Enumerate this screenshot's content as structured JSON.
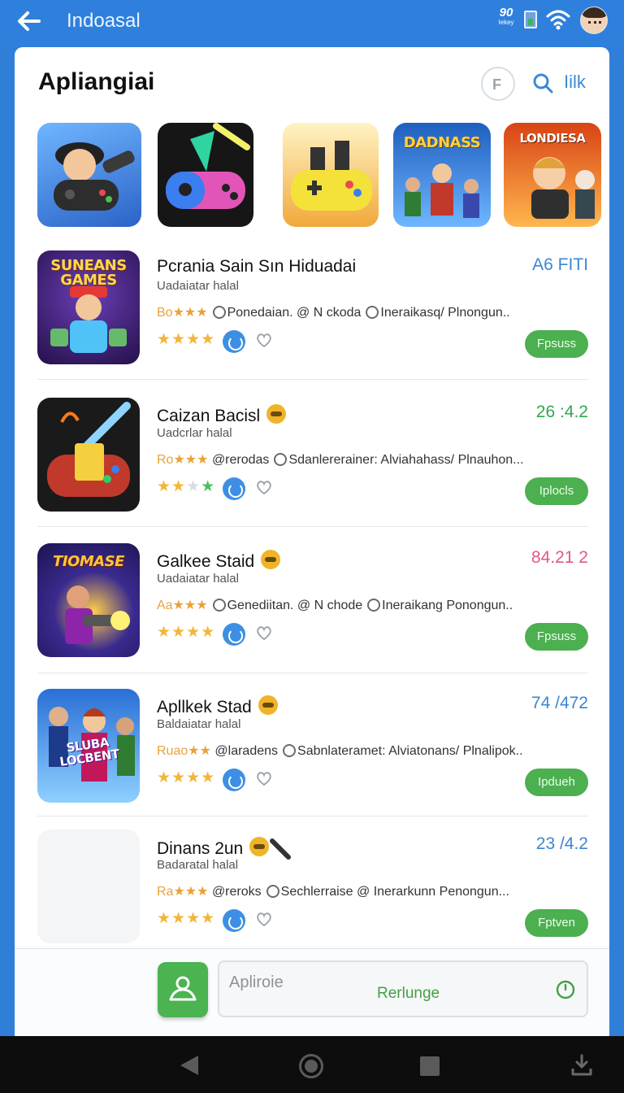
{
  "top_bar": {
    "title": "Indoasal",
    "status_big": "90",
    "status_small": "Iekey"
  },
  "header": {
    "title": "Apliangiai",
    "filter_label": "F",
    "link_label": "Iilk"
  },
  "carousel": [
    {
      "name": "tile-controller-boy",
      "text": ""
    },
    {
      "name": "tile-neon-controller",
      "text": ""
    },
    {
      "name": "tile-yellow-controller",
      "text": ""
    },
    {
      "name": "tile-dadnass",
      "text": "DADNASS"
    },
    {
      "name": "tile-lonnaqesa",
      "text": "LONDIESA"
    }
  ],
  "apps": [
    {
      "name": "Pcrania Sain Sın Hiduadai",
      "sub": "Uadaiatar halal",
      "rating": "Bo★★★",
      "meta": "Ponedaian. @ N ckoda",
      "meta2": "Ineraikasq/ Plnongun..",
      "version": "A6 FITI",
      "version_color": "#3a86d4",
      "action": "Fpsuss",
      "icon_text": "SUNEANS GAMES"
    },
    {
      "name": "Caizan Bacisl",
      "sub": "Uadcrlar halal",
      "rating": "Ro★★★",
      "meta": "@rerodas",
      "meta2": "Sdanlererainer: Alviahahass/ Plnauhon...",
      "version": "26 :4.2",
      "version_color": "#2fa84f",
      "action": "Iplocls",
      "icon_text": ""
    },
    {
      "name": "Galkee Staid",
      "sub": "Uadaiatar halal",
      "rating": "Aa★★★",
      "meta": "Genediitan. @ N chode",
      "meta2": "Ineraikang Ponongun..",
      "version": "84.21 2",
      "version_color": "#e05a82",
      "action": "Fpsuss",
      "icon_text": "TIOMASE"
    },
    {
      "name": "Apllkek Stad",
      "sub": "Baldaiatar halal",
      "rating": "Ruao★★",
      "meta": "@laradens",
      "meta2": "Sabnlateramet: Alviatonans/ Plnalipok..",
      "version": "74 /472",
      "version_color": "#3a86d4",
      "action": "Ipdueh",
      "icon_text": "SLUBA LOCBENT"
    },
    {
      "name": "Dinans 2un",
      "sub": "Badaratal halal",
      "rating": "Ra★★★",
      "meta": "@reroks",
      "meta2": "Sechlerraise @ Inerarkunn Penongun...",
      "version": "23 /4.2",
      "version_color": "#3a86d4",
      "action": "Fptven",
      "icon_text": ""
    }
  ],
  "bottom": {
    "placeholder": "Apliroie",
    "label": "Rerlunge"
  }
}
